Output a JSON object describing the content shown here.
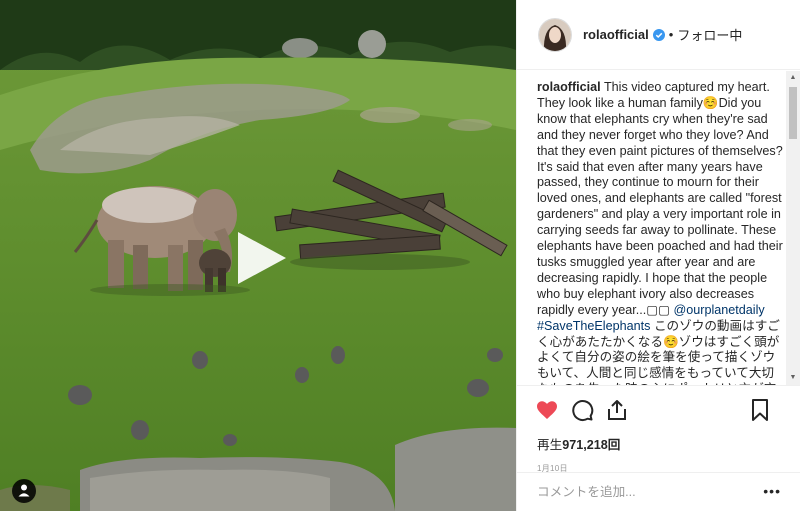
{
  "post": {
    "username": "rolaofficial",
    "follow_status": "フォロー中",
    "separator": "•",
    "caption_user": "rolaofficial",
    "caption_text": "This video captured my heart. They look like a human family☺️Did you know that elephants cry when they're sad and they never forget who they love? And that they even paint pictures of themselves? It's said that even after many years have passed, they continue to mourn for their loved ones, and elephants are called \"forest gardeners\" and play a very important role in carrying seeds far away to pollinate. These elephants have been poached and had their tusks smuggled year after year and are decreasing rapidly. I hope that the people who buy elephant ivory also decreases rapidly every year...▢▢",
    "caption_tags": "@ourplanetdaily #SaveTheElephants",
    "caption_jp": "このゾウの動画はすごく心があたたかくなる☺️ゾウはすごく頭がよくて自分の姿の絵を筆を使って描くゾウもいて、人間と同じ感情をもっていて大切なものを失った時の心にポッカリと穴が空く感情や",
    "views_label": "再生",
    "views_count": "971,218回",
    "date": "1月10日",
    "comment_placeholder": "コメントを追加...",
    "more_label": "•••"
  },
  "colors": {
    "verified": "#3897f0",
    "like": "#ed4956",
    "hashtag": "#003569"
  },
  "icons": [
    "verified-badge-icon",
    "heart-icon",
    "comment-icon",
    "share-icon",
    "bookmark-icon",
    "play-icon",
    "sound-icon"
  ]
}
